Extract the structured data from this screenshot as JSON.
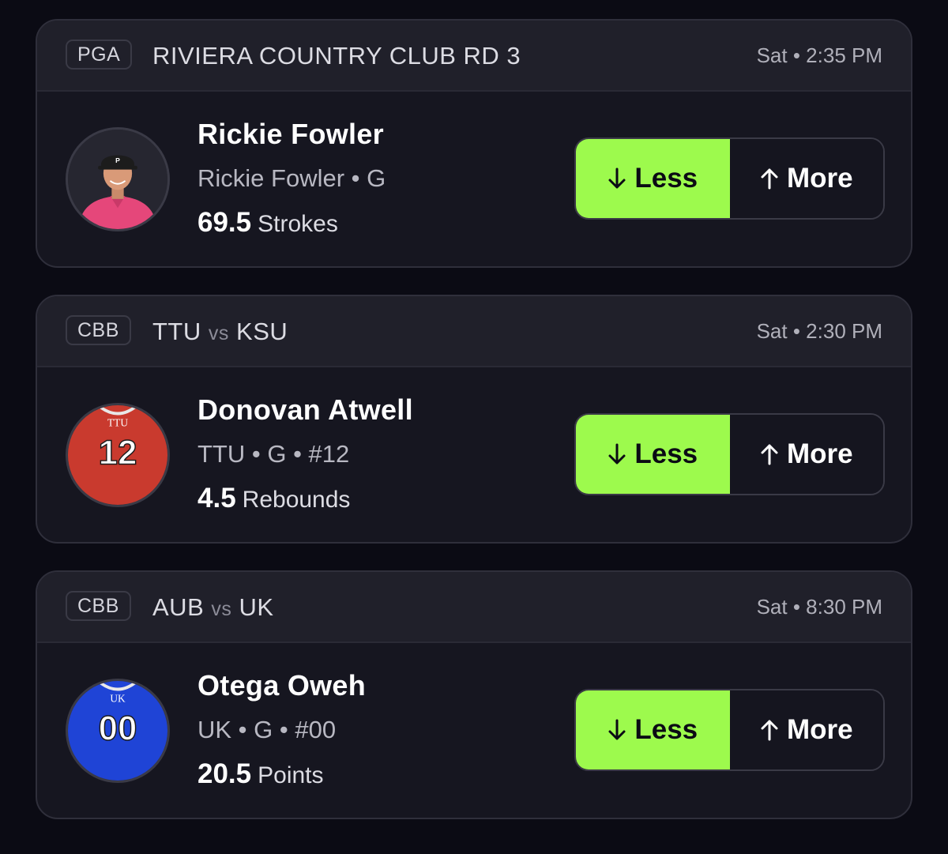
{
  "colors": {
    "background": "#0b0b14",
    "card": "#161620",
    "card_header": "#20202a",
    "less_button": "#9dfa4d",
    "more_button": "#15151f"
  },
  "cards": [
    {
      "league": "PGA",
      "matchup": {
        "text": "RIVIERA COUNTRY CLUB RD 3",
        "team1": "",
        "vs": "",
        "team2": ""
      },
      "time": "Sat • 2:35 PM",
      "player": {
        "name": "Rickie Fowler",
        "meta": "Rickie Fowler • G",
        "avatar_icon": "golfer-photo",
        "avatar_colors": {
          "shirt": "#e5477a",
          "cap": "#1c1c1c"
        }
      },
      "stat": {
        "value": "69.5",
        "name": "Strokes"
      },
      "less_label": "Less",
      "more_label": "More"
    },
    {
      "league": "CBB",
      "matchup": {
        "text": "",
        "team1": "TTU",
        "vs": "vs",
        "team2": "KSU"
      },
      "time": "Sat • 2:30 PM",
      "player": {
        "name": "Donovan Atwell",
        "meta": "TTU • G • #12",
        "avatar_icon": "jersey-icon",
        "jersey": {
          "team": "TTU",
          "number": "12",
          "color": "#c93a2e"
        }
      },
      "stat": {
        "value": "4.5",
        "name": "Rebounds"
      },
      "less_label": "Less",
      "more_label": "More"
    },
    {
      "league": "CBB",
      "matchup": {
        "text": "",
        "team1": "AUB",
        "vs": "vs",
        "team2": "UK"
      },
      "time": "Sat • 8:30 PM",
      "player": {
        "name": "Otega Oweh",
        "meta": "UK • G • #00",
        "avatar_icon": "jersey-icon",
        "jersey": {
          "team": "UK",
          "number": "00",
          "color": "#1f44d6"
        }
      },
      "stat": {
        "value": "20.5",
        "name": "Points"
      },
      "less_label": "Less",
      "more_label": "More"
    }
  ]
}
